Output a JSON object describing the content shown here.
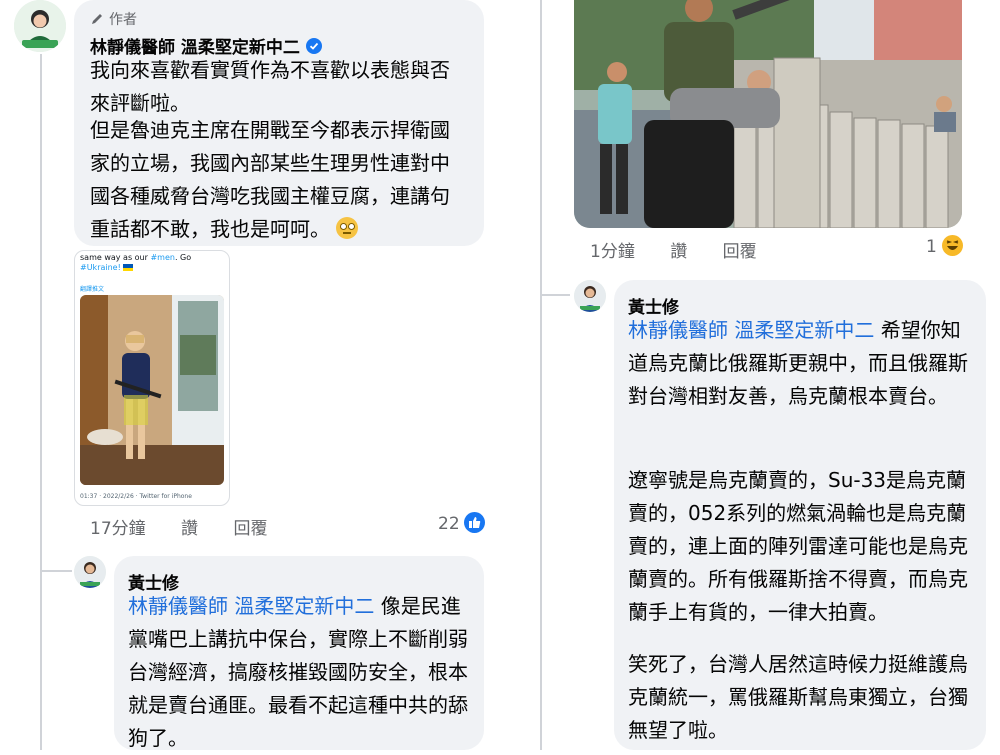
{
  "left_thread": {
    "author_comment": {
      "author_badge": "作者",
      "author_name": "林靜儀醫師 溫柔堅定新中二",
      "paragraph1": "我向來喜歡看實質作為不喜歡以表態與否來評斷啦。",
      "paragraph2": "但是魯迪克主席在開戰至今都表示捍衛國家的立場，我國內部某些生理男性連對中國各種威脅台灣吃我國主權豆腐，連講句重話都不敢，我也是呵呵。",
      "embed": {
        "header_text": "same way as our ",
        "header_tag1": "#men",
        "header_text2": ". Go",
        "header_tag2": "#Ukraine!",
        "translate_link": "翻譯推文",
        "footer": "01:37 · 2022/2/26 · Twitter for iPhone"
      },
      "time": "17分鐘",
      "like_label": "讚",
      "reply_label": "回覆",
      "reaction_count": "22"
    },
    "reply": {
      "author_name": "黃士修",
      "mention": "林靜儀醫師 溫柔堅定新中二",
      "text": " 像是民進黨嘴巴上講抗中保台，實際上不斷削弱台灣經濟，搞廢核摧毀國防安全，根本就是賣台通匪。最看不起這種中共的舔狗了。"
    }
  },
  "right_thread": {
    "photo_meta": {
      "time": "1分鐘",
      "like_label": "讚",
      "reply_label": "回覆",
      "reaction_count": "1"
    },
    "reply": {
      "author_name": "黃士修",
      "mention": "林靜儀醫師 溫柔堅定新中二",
      "text1": " 希望你知道烏克蘭比俄羅斯更親中，而且俄羅斯對台灣相對友善，烏克蘭根本賣台。",
      "text2": "遼寧號是烏克蘭賣的，Su-33是烏克蘭賣的，052系列的燃氣渦輪也是烏克蘭賣的，連上面的陣列雷達可能也是烏克蘭賣的。所有俄羅斯捨不得賣，而烏克蘭手上有貨的，一律大拍賣。",
      "text3": "笑死了，台灣人居然這時候力挺維護烏克蘭統一，罵俄羅斯幫烏東獨立，台獨無望了啦。"
    }
  },
  "colors": {
    "bubble": "#f0f2f5",
    "mention": "#216fdb",
    "meta": "#65676b",
    "verified": "#1877f2"
  }
}
